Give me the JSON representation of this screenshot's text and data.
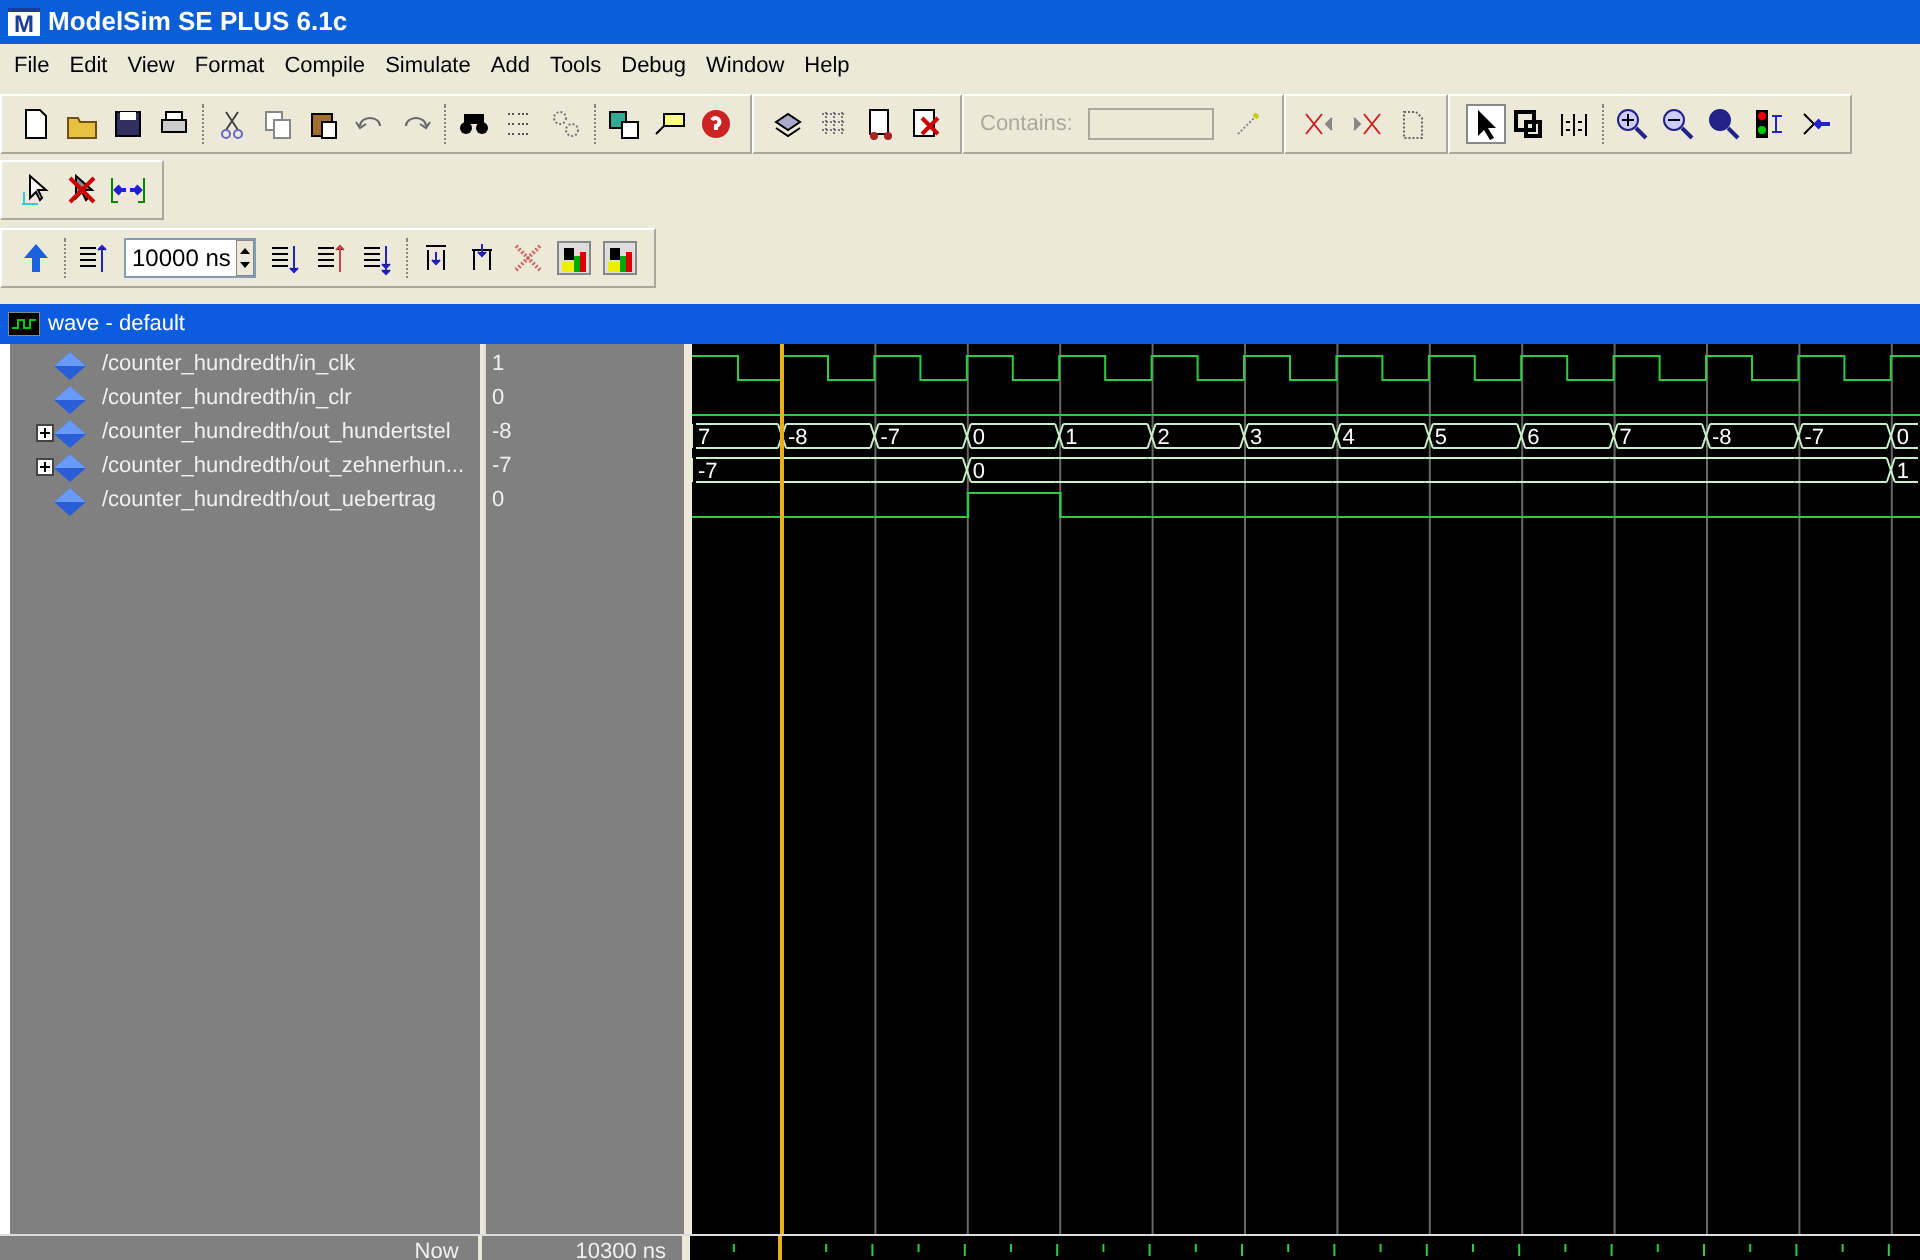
{
  "window": {
    "title": "ModelSim SE PLUS 6.1c",
    "icon_letter": "M"
  },
  "menu": [
    "File",
    "Edit",
    "View",
    "Format",
    "Compile",
    "Simulate",
    "Add",
    "Tools",
    "Debug",
    "Window",
    "Help"
  ],
  "toolbar": {
    "contains_label": "Contains:",
    "run_length": "10000 ns"
  },
  "wave_window": {
    "title": "wave - default"
  },
  "signals": [
    {
      "name": "/counter_hundredth/in_clk",
      "value": "1",
      "expandable": false,
      "kind": "clock"
    },
    {
      "name": "/counter_hundredth/in_clr",
      "value": "0",
      "expandable": false,
      "kind": "bit",
      "high": [
        false,
        false,
        false,
        false,
        false,
        false,
        false,
        false,
        false,
        false,
        false,
        false,
        false,
        false
      ]
    },
    {
      "name": "/counter_hundredth/out_hundertstel",
      "value": "-8",
      "expandable": true,
      "kind": "bus",
      "slots": [
        {
          "change": true,
          "label": "7"
        },
        {
          "change": true,
          "label": "-8"
        },
        {
          "change": true,
          "label": "-7"
        },
        {
          "change": true,
          "label": "0"
        },
        {
          "change": true,
          "label": "1"
        },
        {
          "change": true,
          "label": "2"
        },
        {
          "change": true,
          "label": "3"
        },
        {
          "change": true,
          "label": "4"
        },
        {
          "change": true,
          "label": "5"
        },
        {
          "change": true,
          "label": "6"
        },
        {
          "change": true,
          "label": "7"
        },
        {
          "change": true,
          "label": "-8"
        },
        {
          "change": true,
          "label": "-7"
        },
        {
          "change": true,
          "label": "0"
        }
      ]
    },
    {
      "name": "/counter_hundredth/out_zehnerhun...",
      "value": "-7",
      "expandable": true,
      "kind": "bus",
      "slots": [
        {
          "change": true,
          "label": "-7"
        },
        {
          "change": false
        },
        {
          "change": false
        },
        {
          "change": true,
          "label": "0"
        },
        {
          "change": false
        },
        {
          "change": false
        },
        {
          "change": false
        },
        {
          "change": false
        },
        {
          "change": false
        },
        {
          "change": false
        },
        {
          "change": false
        },
        {
          "change": false
        },
        {
          "change": false
        },
        {
          "change": true,
          "label": "1"
        }
      ]
    },
    {
      "name": "/counter_hundredth/out_uebertrag",
      "value": "0",
      "expandable": false,
      "kind": "bit",
      "high": [
        false,
        false,
        false,
        true,
        false,
        false,
        false,
        false,
        false,
        false,
        false,
        false,
        false,
        false
      ]
    }
  ],
  "footer": {
    "label": "Now",
    "time": "10300 ns"
  }
}
